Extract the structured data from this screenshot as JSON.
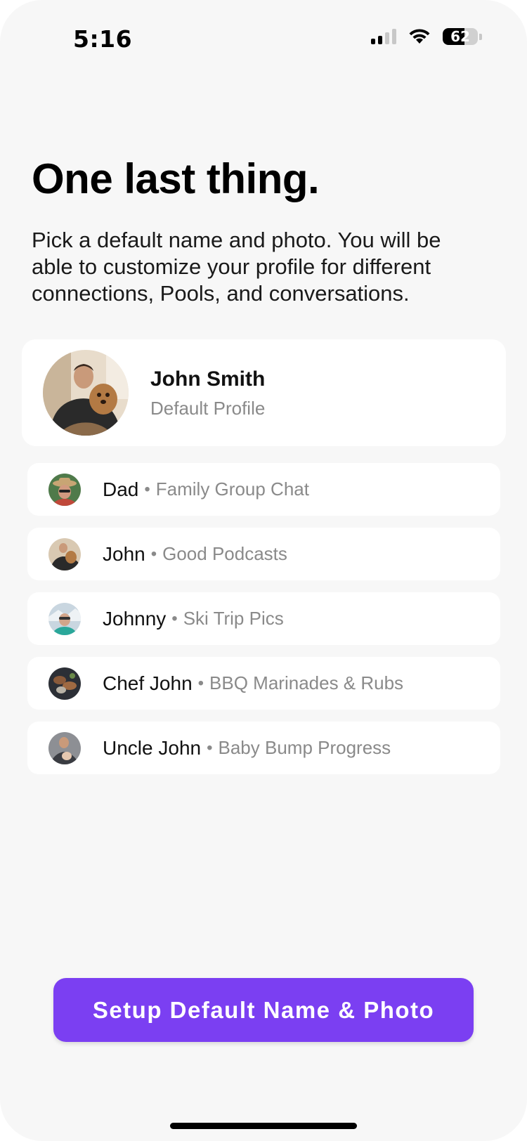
{
  "status_bar": {
    "time": "5:16",
    "battery_percent": "62",
    "battery_level": 0.62,
    "signal_icon": "cellular-signal-icon",
    "wifi_icon": "wifi-icon"
  },
  "header": {
    "title": "One last thing.",
    "subtitle": "Pick a default name and photo. You will be able to customize your profile for different connections, Pools, and conversations."
  },
  "default_profile": {
    "name": "John Smith",
    "label": "Default Profile"
  },
  "profiles": [
    {
      "name": "Dad",
      "group": "Family Group Chat"
    },
    {
      "name": "John",
      "group": "Good Podcasts"
    },
    {
      "name": "Johnny",
      "group": "Ski Trip Pics"
    },
    {
      "name": "Chef John",
      "group": "BBQ Marinades & Rubs"
    },
    {
      "name": "Uncle John",
      "group": "Baby Bump Progress"
    }
  ],
  "separator": "•",
  "primary_button": {
    "label": "Setup Default Name & Photo"
  },
  "colors": {
    "accent": "#7b3ff2",
    "background": "#f7f7f7",
    "card": "#ffffff",
    "secondary_text": "#8a8a8a"
  }
}
